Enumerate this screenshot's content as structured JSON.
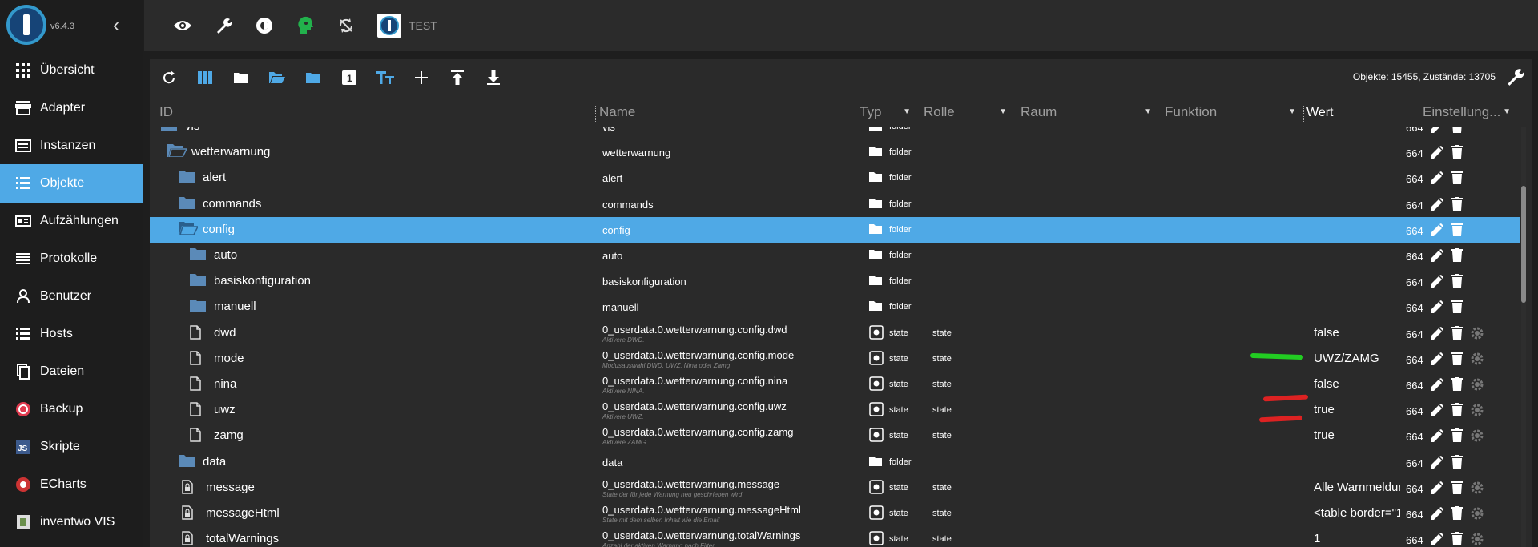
{
  "app": {
    "version": "v6.4.3",
    "instance": "TEST"
  },
  "sidebar": {
    "items": [
      {
        "label": "Übersicht",
        "icon": "grid-icon"
      },
      {
        "label": "Adapter",
        "icon": "store-icon"
      },
      {
        "label": "Instanzen",
        "icon": "instances-icon"
      },
      {
        "label": "Objekte",
        "icon": "list-icon"
      },
      {
        "label": "Aufzählungen",
        "icon": "enum-icon"
      },
      {
        "label": "Protokolle",
        "icon": "log-icon"
      },
      {
        "label": "Benutzer",
        "icon": "user-icon"
      },
      {
        "label": "Hosts",
        "icon": "hosts-icon"
      },
      {
        "label": "Dateien",
        "icon": "files-icon"
      },
      {
        "label": "Backup",
        "icon": "backup-icon"
      },
      {
        "label": "Skripte",
        "icon": "js-icon"
      },
      {
        "label": "ECharts",
        "icon": "echarts-icon"
      },
      {
        "label": "inventwo VIS",
        "icon": "inventwo-icon"
      }
    ],
    "active": "Objekte"
  },
  "toolbar": {
    "counts": "Objekte: 15455, Zustände: 13705"
  },
  "header": {
    "id": "ID",
    "name": "Name",
    "typ": "Typ",
    "rolle": "Rolle",
    "raum": "Raum",
    "funktion": "Funktion",
    "wert": "Wert",
    "settings": "Einstellung..."
  },
  "rows": [
    {
      "id": "vis",
      "name": "vis",
      "type": "folder",
      "acl": "664"
    },
    {
      "id": "wetterwarnung",
      "name": "wetterwarnung",
      "type": "folder",
      "acl": "664"
    },
    {
      "id": "alert",
      "name": "alert",
      "type": "folder",
      "acl": "664"
    },
    {
      "id": "commands",
      "name": "commands",
      "type": "folder",
      "acl": "664"
    },
    {
      "id": "config",
      "name": "config",
      "type": "folder",
      "acl": "664"
    },
    {
      "id": "auto",
      "name": "auto",
      "type": "folder",
      "acl": "664"
    },
    {
      "id": "basiskonfiguration",
      "name": "basiskonfiguration",
      "type": "folder",
      "acl": "664"
    },
    {
      "id": "manuell",
      "name": "manuell",
      "type": "folder",
      "acl": "664"
    },
    {
      "id": "dwd",
      "name": "0_userdata.0.wetterwarnung.config.dwd",
      "desc": "Aktivere DWD.",
      "type": "state",
      "role": "state",
      "value": "false",
      "acl": "664"
    },
    {
      "id": "mode",
      "name": "0_userdata.0.wetterwarnung.config.mode",
      "desc": "Modusauswahl DWD, UWZ, Nina oder Zamg",
      "type": "state",
      "role": "state",
      "value": "UWZ/ZAMG",
      "acl": "664"
    },
    {
      "id": "nina",
      "name": "0_userdata.0.wetterwarnung.config.nina",
      "desc": "Aktivere NINA.",
      "type": "state",
      "role": "state",
      "value": "false",
      "acl": "664"
    },
    {
      "id": "uwz",
      "name": "0_userdata.0.wetterwarnung.config.uwz",
      "desc": "Aktivere UWZ.",
      "type": "state",
      "role": "state",
      "value": "true",
      "acl": "664"
    },
    {
      "id": "zamg",
      "name": "0_userdata.0.wetterwarnung.config.zamg",
      "desc": "Aktivere ZAMG.",
      "type": "state",
      "role": "state",
      "value": "true",
      "acl": "664"
    },
    {
      "id": "data",
      "name": "data",
      "type": "folder",
      "acl": "664"
    },
    {
      "id": "message",
      "name": "0_userdata.0.wetterwarnung.message",
      "desc": "State der für jede Warnung neu geschrieben wird",
      "type": "state",
      "role": "state",
      "value": "Alle Warnmeldun...",
      "acl": "664"
    },
    {
      "id": "messageHtml",
      "name": "0_userdata.0.wetterwarnung.messageHtml",
      "desc": "State mit dem selben Inhalt wie die Email",
      "type": "state",
      "role": "state",
      "value": "<table border=\"1...",
      "acl": "664"
    },
    {
      "id": "totalWarnings",
      "name": "0_userdata.0.wetterwarnung.totalWarnings",
      "desc": "Anzahl der aktiven Warnung nach Filter",
      "type": "state",
      "role": "state",
      "value": "1",
      "acl": "664"
    }
  ],
  "colors": {
    "accent": "#4fa9e6",
    "folder_icon": "#5b8ab8",
    "green_mark": "#22cc22",
    "red_mark": "#dd2222"
  }
}
